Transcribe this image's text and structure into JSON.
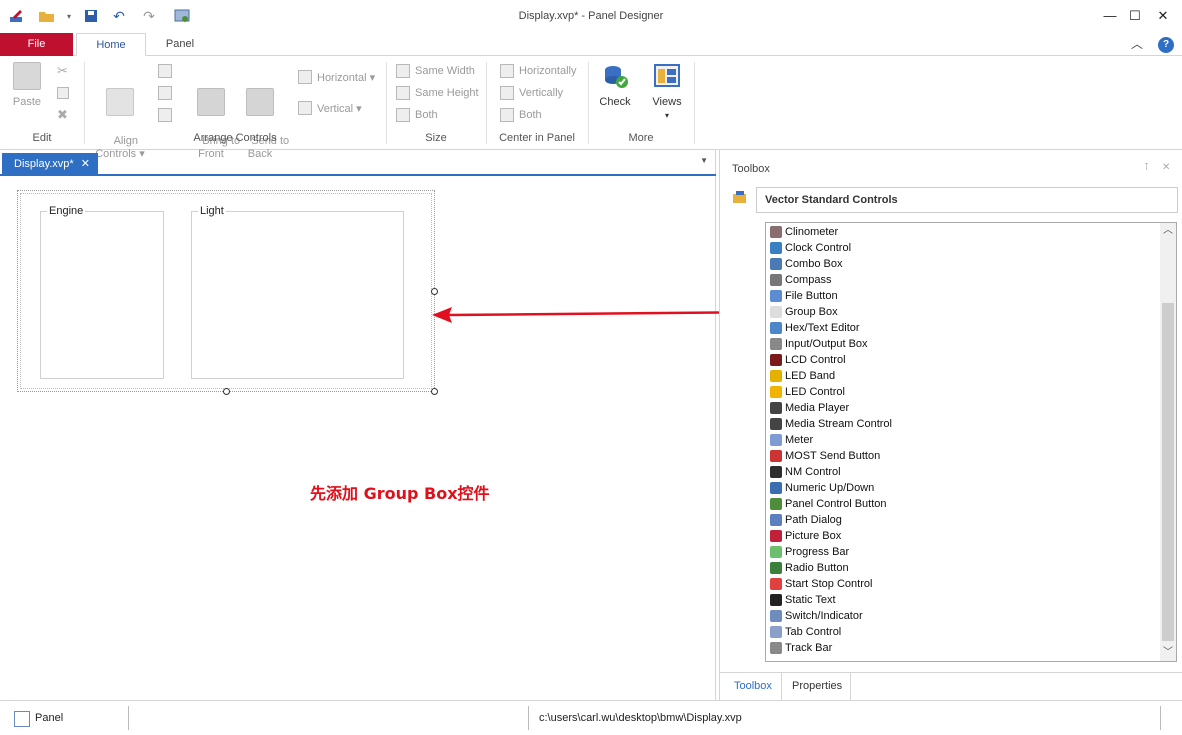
{
  "window": {
    "title": "Display.xvp* - Panel Designer"
  },
  "ribbon": {
    "tabs": [
      {
        "label": "File"
      },
      {
        "label": "Home"
      },
      {
        "label": "Panel"
      }
    ],
    "groups": {
      "edit": {
        "label": "Edit",
        "paste": "Paste"
      },
      "arrange": {
        "label": "Arrange Controls",
        "align": "Align\nControls ▾",
        "front": "Bring to\nFront",
        "back": "Send to\nBack",
        "horizontal": "Horizontal ▾",
        "vertical": "Vertical ▾"
      },
      "size": {
        "label": "Size",
        "same_width": "Same Width",
        "same_height": "Same Height",
        "both": "Both"
      },
      "center": {
        "label": "Center in Panel",
        "horizontally": "Horizontally",
        "vertically": "Vertically",
        "both": "Both"
      },
      "more": {
        "label": "More",
        "check": "Check",
        "views": "Views"
      }
    }
  },
  "document": {
    "tab_label": "Display.xvp*",
    "groupboxes": [
      {
        "label": "Engine"
      },
      {
        "label": "Light"
      }
    ],
    "annotation": "先添加 Group Box控件"
  },
  "toolbox": {
    "title": "Toolbox",
    "category": "Vector Standard Controls",
    "items": [
      {
        "label": "Clinometer",
        "color": "#8a6d6d"
      },
      {
        "label": "Clock Control",
        "color": "#3a7fc4"
      },
      {
        "label": "Combo Box",
        "color": "#4a79b4"
      },
      {
        "label": "Compass",
        "color": "#777777"
      },
      {
        "label": "File Button",
        "color": "#5b8bd0"
      },
      {
        "label": "Group Box",
        "color": "#dddddd"
      },
      {
        "label": "Hex/Text Editor",
        "color": "#4b86c9"
      },
      {
        "label": "Input/Output Box",
        "color": "#888888"
      },
      {
        "label": "LCD Control",
        "color": "#7a1a1a"
      },
      {
        "label": "LED Band",
        "color": "#e5b100"
      },
      {
        "label": "LED Control",
        "color": "#f0b400"
      },
      {
        "label": "Media Player",
        "color": "#444444"
      },
      {
        "label": "Media Stream Control",
        "color": "#444444"
      },
      {
        "label": "Meter",
        "color": "#7e9bd3"
      },
      {
        "label": "MOST Send Button",
        "color": "#cc3333"
      },
      {
        "label": "NM Control",
        "color": "#2e2e2e"
      },
      {
        "label": "Numeric Up/Down",
        "color": "#3a6eb0"
      },
      {
        "label": "Panel Control Button",
        "color": "#4e8d3a"
      },
      {
        "label": "Path Dialog",
        "color": "#5b7fbf"
      },
      {
        "label": "Picture Box",
        "color": "#c0203a"
      },
      {
        "label": "Progress Bar",
        "color": "#6cbf6c"
      },
      {
        "label": "Radio Button",
        "color": "#3a7f3a"
      },
      {
        "label": "Start Stop Control",
        "color": "#e04040"
      },
      {
        "label": "Static Text",
        "color": "#222222"
      },
      {
        "label": "Switch/Indicator",
        "color": "#6f8cbf"
      },
      {
        "label": "Tab Control",
        "color": "#8aa0c8"
      },
      {
        "label": "Track Bar",
        "color": "#888888"
      }
    ],
    "tabs": [
      {
        "label": "Toolbox"
      },
      {
        "label": "Properties"
      }
    ]
  },
  "statusbar": {
    "mode": "Panel",
    "path": "c:\\users\\carl.wu\\desktop\\bmw\\Display.xvp"
  }
}
